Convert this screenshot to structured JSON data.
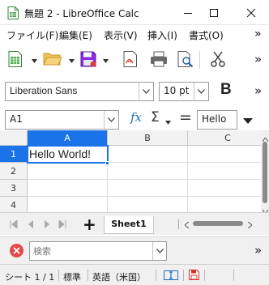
{
  "titlebar": {
    "title": "無題 2 - LibreOffice Calc"
  },
  "menubar": {
    "items": [
      {
        "label": "ファイル(F)"
      },
      {
        "label": "編集(E)"
      },
      {
        "label": "表示(V)"
      },
      {
        "label": "挿入(I)"
      },
      {
        "label": "書式(O)"
      }
    ],
    "overflow": "»"
  },
  "toolbar": {
    "overflow": "»"
  },
  "formatbar": {
    "font_name": "Liberation Sans",
    "font_size": "10 pt",
    "bold_label": "B"
  },
  "formulabar": {
    "name_box": "A1",
    "function_label": "fx",
    "sum_label": "Σ",
    "equals_label": "=",
    "input_value": "Hello"
  },
  "grid": {
    "columns": [
      "A",
      "B",
      "C"
    ],
    "rows": [
      "1",
      "2",
      "3",
      "4"
    ],
    "cells": {
      "A1": "Hello World!"
    },
    "selected_cell": "A1",
    "accent_color": "#0078d7"
  },
  "sheets": {
    "add_label": "+",
    "tabs": [
      {
        "label": "Sheet1",
        "active": true
      }
    ]
  },
  "findbar": {
    "placeholder": "検索",
    "overflow": "»"
  },
  "statusbar": {
    "sheet": "シート 1 / 1",
    "style": "標準",
    "language": "英語（米国）"
  }
}
